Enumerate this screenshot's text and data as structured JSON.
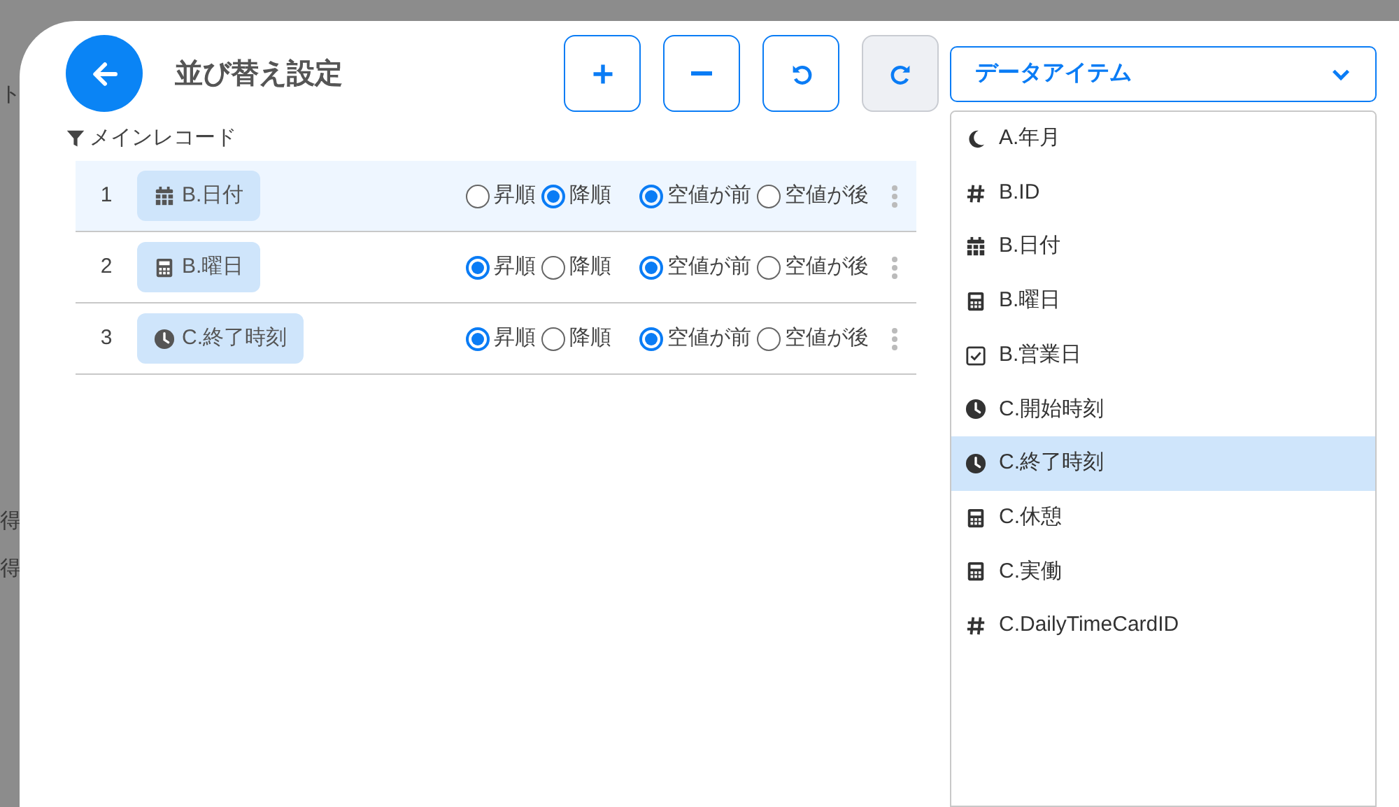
{
  "background_texts": [
    "ト",
    "得",
    "得"
  ],
  "header": {
    "title": "並び替え設定"
  },
  "toolbar": [
    {
      "kind": "add",
      "disabled": false
    },
    {
      "kind": "remove",
      "disabled": false
    },
    {
      "kind": "undo",
      "disabled": false
    },
    {
      "kind": "redo",
      "disabled": true
    }
  ],
  "section_label": "メインレコード",
  "rows": [
    {
      "number": "1",
      "selected": true,
      "field": {
        "kind": "calendar",
        "label": "B.日付"
      },
      "order": [
        {
          "label": "昇順",
          "selected": false
        },
        {
          "label": "降順",
          "selected": true
        }
      ],
      "nulls": [
        {
          "label": "空値が前",
          "selected": true
        },
        {
          "label": "空値が後",
          "selected": false
        }
      ]
    },
    {
      "number": "2",
      "selected": false,
      "field": {
        "kind": "calculator",
        "label": "B.曜日"
      },
      "order": [
        {
          "label": "昇順",
          "selected": true
        },
        {
          "label": "降順",
          "selected": false
        }
      ],
      "nulls": [
        {
          "label": "空値が前",
          "selected": true
        },
        {
          "label": "空値が後",
          "selected": false
        }
      ]
    },
    {
      "number": "3",
      "selected": false,
      "field": {
        "kind": "clock",
        "label": "C.終了時刻"
      },
      "order": [
        {
          "label": "昇順",
          "selected": true
        },
        {
          "label": "降順",
          "selected": false
        }
      ],
      "nulls": [
        {
          "label": "空値が前",
          "selected": true
        },
        {
          "label": "空値が後",
          "selected": false
        }
      ]
    }
  ],
  "dropdown": {
    "value": "データアイテム",
    "expanded": true,
    "options": [
      {
        "kind": "moon",
        "label": "A.年月",
        "selected": false
      },
      {
        "kind": "hash",
        "label": "B.ID",
        "selected": false
      },
      {
        "kind": "calendar",
        "label": "B.日付",
        "selected": false
      },
      {
        "kind": "calculator",
        "label": "B.曜日",
        "selected": false
      },
      {
        "kind": "checkbox",
        "label": "B.営業日",
        "selected": false
      },
      {
        "kind": "clock",
        "label": "C.開始時刻",
        "selected": false
      },
      {
        "kind": "clock",
        "label": "C.終了時刻",
        "selected": true
      },
      {
        "kind": "calculator",
        "label": "C.休憩",
        "selected": false
      },
      {
        "kind": "calculator",
        "label": "C.実働",
        "selected": false
      },
      {
        "kind": "hash",
        "label": "C.DailyTimeCardID",
        "selected": false
      }
    ]
  }
}
